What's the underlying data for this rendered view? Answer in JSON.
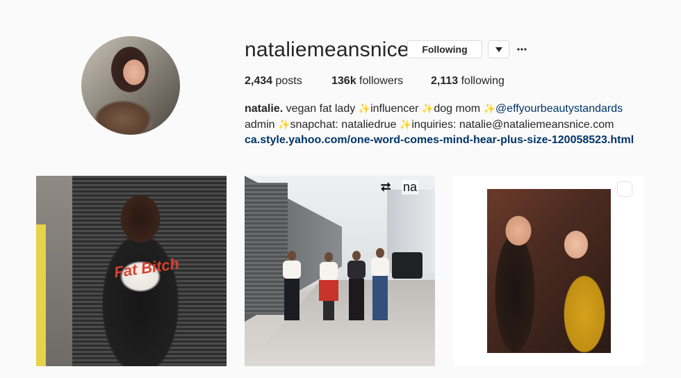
{
  "profile": {
    "username": "nataliemeansnice",
    "following_button": "Following",
    "stats": {
      "posts_count": "2,434",
      "posts_label": "posts",
      "followers_count": "136k",
      "followers_label": "followers",
      "following_count": "2,113",
      "following_label": "following"
    },
    "bio": {
      "name": "natalie.",
      "line1_text": " vegan fat lady ",
      "line1_part2": "influencer ",
      "line1_part3": "dog mom ",
      "mention": "@effyourbeautystandards",
      "line2_part1": "admin ",
      "line2_part2": "snapchat: nataliedrue ",
      "line2_part3": "inquiries: natalie@nataliemeansnice.com",
      "link": "ca.style.yahoo.com/one-word-comes-mind-hear-plus-size-120058523.html",
      "sparkle": "✨"
    }
  },
  "posts": [
    {
      "shirt_text": "Fat Bitch"
    },
    {
      "repost_label": "⮂",
      "overlay_tag": "na"
    },
    {}
  ],
  "colors": {
    "link": "#003569",
    "text": "#262626",
    "background": "#fafafa",
    "border": "#dbdbdb"
  },
  "icons": {
    "caret": "caret-down-icon",
    "more": "more-options-icon",
    "repost": "repost-icon",
    "multi_select": "checkbox-icon"
  }
}
